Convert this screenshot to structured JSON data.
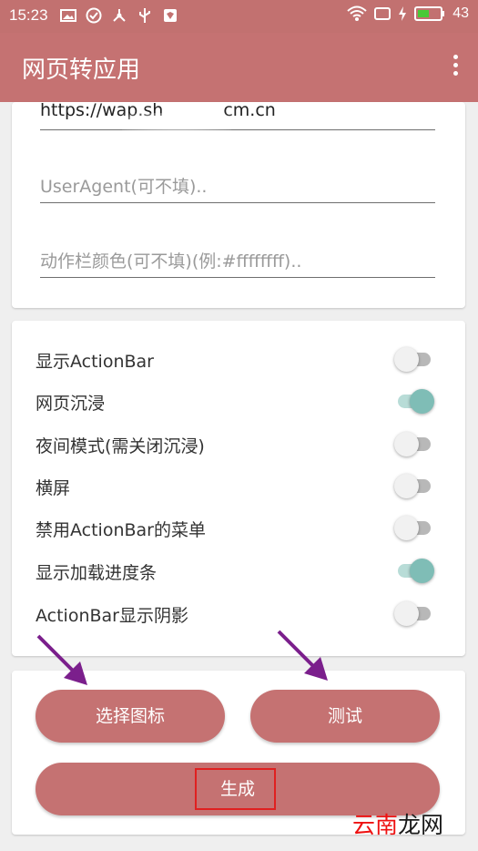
{
  "status_bar": {
    "time": "15:23",
    "battery": "43",
    "left_icons": [
      "image-icon",
      "check-circle-icon",
      "network-icon",
      "usb-icon",
      "shield-icon"
    ],
    "right_icons": [
      "wifi-icon",
      "screen-icon",
      "charging-icon",
      "battery-icon"
    ]
  },
  "app_bar": {
    "title": "网页转应用",
    "menu_icon": "more-vert-icon"
  },
  "form": {
    "url_value": "https://wap.sh",
    "url_tail": "cm.cn",
    "user_agent_placeholder": "UserAgent(可不填)..",
    "actionbar_color_placeholder": "动作栏颜色(可不填)(例:#ffffffff).."
  },
  "options": [
    {
      "label": "显示ActionBar",
      "on": false
    },
    {
      "label": "网页沉浸",
      "on": true
    },
    {
      "label": "夜间模式(需关闭沉浸)",
      "on": false
    },
    {
      "label": "横屏",
      "on": false
    },
    {
      "label": "禁用ActionBar的菜单",
      "on": false
    },
    {
      "label": "显示加载进度条",
      "on": true
    },
    {
      "label": "ActionBar显示阴影",
      "on": false
    }
  ],
  "buttons": {
    "choose_icon": "选择图标",
    "test": "测试",
    "generate": "生成"
  },
  "watermark": {
    "part1": "云南",
    "part2": "龙网"
  },
  "colors": {
    "primary": "#c57272",
    "switch_on": "#7fbdb6",
    "annotation_arrow": "#7b1f8c",
    "highlight_box": "#e02020"
  }
}
